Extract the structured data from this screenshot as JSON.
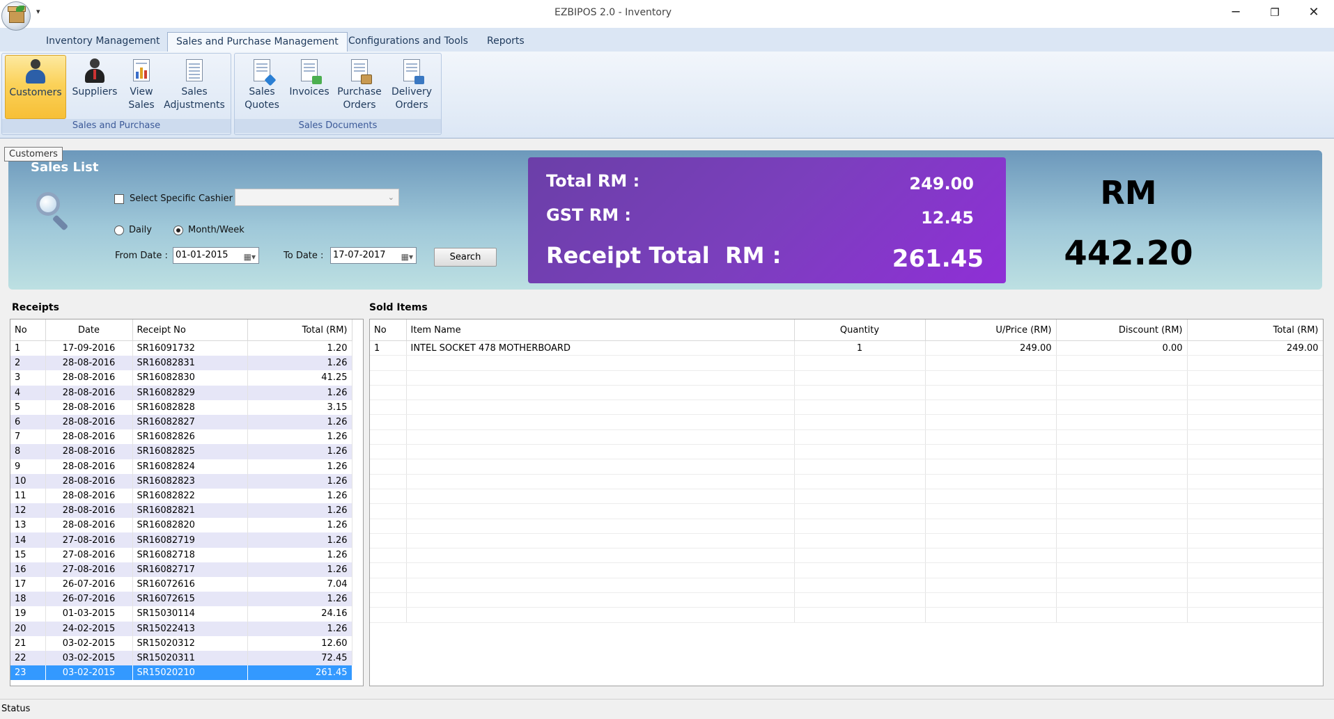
{
  "window": {
    "title": "EZBIPOS 2.0 - Inventory",
    "minimize_glyph": "─",
    "maximize_glyph": "❐",
    "close_glyph": "✕",
    "qat_glyph": "▾"
  },
  "tabs": [
    {
      "label": "Inventory Management",
      "active": false
    },
    {
      "label": "Sales and Purchase Management",
      "active": true
    },
    {
      "label": "Configurations and Tools",
      "active": false
    },
    {
      "label": "Reports",
      "active": false
    }
  ],
  "ribbon": {
    "groups": [
      {
        "label": "Sales and Purchase",
        "buttons": [
          {
            "label": "Customers",
            "icon": "customers-icon",
            "active": true
          },
          {
            "label": "Suppliers",
            "icon": "suppliers-icon",
            "active": false
          },
          {
            "label": "View\nSales",
            "icon": "view-sales-icon",
            "active": false
          },
          {
            "label": "Sales\nAdjustments",
            "icon": "sales-adjustments-icon",
            "active": false
          }
        ]
      },
      {
        "label": "Sales Documents",
        "buttons": [
          {
            "label": "Sales\nQuotes",
            "icon": "sales-quotes-icon",
            "active": false
          },
          {
            "label": "Invoices",
            "icon": "invoices-icon",
            "active": false
          },
          {
            "label": "Purchase\nOrders",
            "icon": "purchase-orders-icon",
            "active": false
          },
          {
            "label": "Delivery\nOrders",
            "icon": "delivery-orders-icon",
            "active": false
          }
        ]
      }
    ]
  },
  "tooltip": "Customers",
  "sales_panel": {
    "title": "Sales List",
    "select_cashier_label": "Select Specific Cashier",
    "select_cashier_checked": false,
    "cashier_value": "",
    "radio_daily": "Daily",
    "radio_monthweek": "Month/Week",
    "selected_period": "Month/Week",
    "from_date_label": "From Date :",
    "from_date": "01-01-2015",
    "to_date_label": "To Date :",
    "to_date": "17-07-2017",
    "search_label": "Search"
  },
  "totals": {
    "total_label": "Total RM :",
    "total_value": "249.00",
    "gst_label": "GST RM :",
    "gst_value": "12.45",
    "receipt_total_label": "Receipt Total  RM :",
    "receipt_total_value": "261.45",
    "grand_currency": "RM",
    "grand_value": "442.20"
  },
  "receipts": {
    "title": "Receipts",
    "columns": [
      "No",
      "Date",
      "Receipt No",
      "Total (RM)"
    ],
    "rows": [
      [
        "1",
        "17-09-2016",
        "SR16091732",
        "1.20"
      ],
      [
        "2",
        "28-08-2016",
        "SR16082831",
        "1.26"
      ],
      [
        "3",
        "28-08-2016",
        "SR16082830",
        "41.25"
      ],
      [
        "4",
        "28-08-2016",
        "SR16082829",
        "1.26"
      ],
      [
        "5",
        "28-08-2016",
        "SR16082828",
        "3.15"
      ],
      [
        "6",
        "28-08-2016",
        "SR16082827",
        "1.26"
      ],
      [
        "7",
        "28-08-2016",
        "SR16082826",
        "1.26"
      ],
      [
        "8",
        "28-08-2016",
        "SR16082825",
        "1.26"
      ],
      [
        "9",
        "28-08-2016",
        "SR16082824",
        "1.26"
      ],
      [
        "10",
        "28-08-2016",
        "SR16082823",
        "1.26"
      ],
      [
        "11",
        "28-08-2016",
        "SR16082822",
        "1.26"
      ],
      [
        "12",
        "28-08-2016",
        "SR16082821",
        "1.26"
      ],
      [
        "13",
        "28-08-2016",
        "SR16082820",
        "1.26"
      ],
      [
        "14",
        "27-08-2016",
        "SR16082719",
        "1.26"
      ],
      [
        "15",
        "27-08-2016",
        "SR16082718",
        "1.26"
      ],
      [
        "16",
        "27-08-2016",
        "SR16082717",
        "1.26"
      ],
      [
        "17",
        "26-07-2016",
        "SR16072616",
        "7.04"
      ],
      [
        "18",
        "26-07-2016",
        "SR16072615",
        "1.26"
      ],
      [
        "19",
        "01-03-2015",
        "SR15030114",
        "24.16"
      ],
      [
        "20",
        "24-02-2015",
        "SR15022413",
        "1.26"
      ],
      [
        "21",
        "03-02-2015",
        "SR15020312",
        "12.60"
      ],
      [
        "22",
        "03-02-2015",
        "SR15020311",
        "72.45"
      ],
      [
        "23",
        "03-02-2015",
        "SR15020210",
        "261.45"
      ]
    ],
    "selected_index": 22
  },
  "sold_items": {
    "title": "Sold Items",
    "columns": [
      "No",
      "Item Name",
      "Quantity",
      "U/Price (RM)",
      "Discount (RM)",
      "Total (RM)"
    ],
    "rows": [
      [
        "1",
        "INTEL SOCKET 478 MOTHERBOARD",
        "1",
        "249.00",
        "0.00",
        "249.00"
      ]
    ],
    "empty_rows": 18
  },
  "status": "Status",
  "colors": {
    "accent": "#3399ff",
    "totals_box": "#7b3fbd",
    "ribbon_active": "#fbd25a"
  }
}
